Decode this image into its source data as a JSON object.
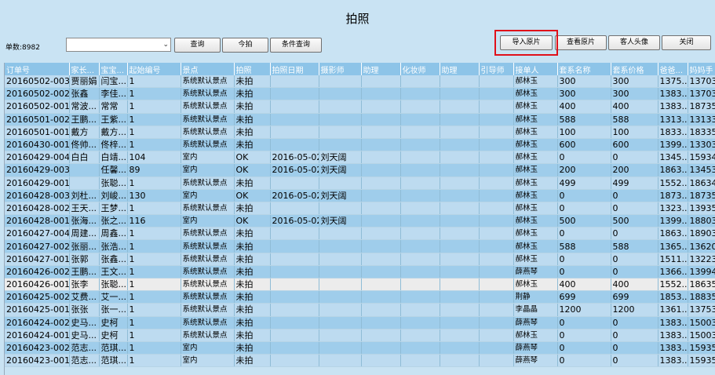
{
  "title": "拍照",
  "order_count": "单数:8982",
  "toolbar_left": [
    "查询",
    "今拍",
    "条件查询"
  ],
  "toolbar_right": [
    "导入原片",
    "查看原片",
    "客人头像",
    "关闭"
  ],
  "columns": [
    "订单号",
    "家长...",
    "宝宝...",
    "起始编号",
    "景点",
    "拍照",
    "拍照日期",
    "摄影师",
    "助理",
    "化妆师",
    "助理",
    "引导师",
    "接单人",
    "套系名称",
    "套系价格",
    "爸爸...",
    "妈妈手"
  ],
  "rows": [
    [
      "20160502-003",
      "贾丽娟",
      "闫宝...",
      "1",
      "系统默认景点",
      "未拍",
      "",
      "",
      "",
      "",
      "",
      "",
      "郝林玉",
      "300",
      "300",
      "1375...",
      "13703"
    ],
    [
      "20160502-002",
      "张鑫",
      "李佳...",
      "1",
      "系统默认景点",
      "未拍",
      "",
      "",
      "",
      "",
      "",
      "",
      "郝林玉",
      "300",
      "300",
      "1383...",
      "13703"
    ],
    [
      "20160502-001",
      "常波...",
      "常常",
      "1",
      "系统默认景点",
      "未拍",
      "",
      "",
      "",
      "",
      "",
      "",
      "郝林玉",
      "400",
      "400",
      "1383...",
      "18735"
    ],
    [
      "20160501-002",
      "王鹏...",
      "王紫...",
      "1",
      "系统默认景点",
      "未拍",
      "",
      "",
      "",
      "",
      "",
      "",
      "郝林玉",
      "588",
      "588",
      "1313...",
      "13133"
    ],
    [
      "20160501-001",
      "戴方",
      "戴方...",
      "1",
      "系统默认景点",
      "未拍",
      "",
      "",
      "",
      "",
      "",
      "",
      "郝林玉",
      "100",
      "100",
      "1833...",
      "18335"
    ],
    [
      "20160430-001",
      "佟帅...",
      "佟梓...",
      "1",
      "系统默认景点",
      "未拍",
      "",
      "",
      "",
      "",
      "",
      "",
      "郝林玉",
      "600",
      "600",
      "1399...",
      "13303"
    ],
    [
      "20160429-004",
      "白白",
      "白靖...",
      "104",
      "室内",
      "OK",
      "2016-05-02",
      "刘天阔",
      "",
      "",
      "",
      "",
      "郝林玉",
      "0",
      "0",
      "1345...",
      "15934"
    ],
    [
      "20160429-003",
      "",
      "任馨...",
      "89",
      "室内",
      "OK",
      "2016-05-02",
      "刘天阔",
      "",
      "",
      "",
      "",
      "郝林玉",
      "200",
      "200",
      "1863...",
      "13453"
    ],
    [
      "20160429-001",
      "",
      "张聪...",
      "1",
      "系统默认景点",
      "未拍",
      "",
      "",
      "",
      "",
      "",
      "",
      "郝林玉",
      "499",
      "499",
      "1552...",
      "18634"
    ],
    [
      "20160428-003",
      "刘杜...",
      "刘峻...",
      "130",
      "室内",
      "OK",
      "2016-05-02",
      "刘天阔",
      "",
      "",
      "",
      "",
      "郝林玉",
      "0",
      "0",
      "1873...",
      "18735"
    ],
    [
      "20160428-002",
      "王天...",
      "王梦...",
      "1",
      "系统默认景点",
      "未拍",
      "",
      "",
      "",
      "",
      "",
      "",
      "郝林玉",
      "0",
      "0",
      "1323...",
      "13935"
    ],
    [
      "20160428-001",
      "张海...",
      "张之...",
      "116",
      "室内",
      "OK",
      "2016-05-02",
      "刘天阔",
      "",
      "",
      "",
      "",
      "郝林玉",
      "500",
      "500",
      "1399...",
      "18803"
    ],
    [
      "20160427-004",
      "周建...",
      "周鑫...",
      "1",
      "系统默认景点",
      "未拍",
      "",
      "",
      "",
      "",
      "",
      "",
      "郝林玉",
      "0",
      "0",
      "1863...",
      "18903"
    ],
    [
      "20160427-002",
      "张丽...",
      "张浩...",
      "1",
      "系统默认景点",
      "未拍",
      "",
      "",
      "",
      "",
      "",
      "",
      "郝林玉",
      "588",
      "588",
      "1365...",
      "13620"
    ],
    [
      "20160427-001",
      "张郭",
      "张鑫...",
      "1",
      "系统默认景点",
      "未拍",
      "",
      "",
      "",
      "",
      "",
      "",
      "郝林玉",
      "0",
      "0",
      "1511...",
      "13223"
    ],
    [
      "20160426-002",
      "王鹏...",
      "王文...",
      "1",
      "系统默认景点",
      "未拍",
      "",
      "",
      "",
      "",
      "",
      "",
      "薛燕琴",
      "0",
      "0",
      "1366...",
      "13994"
    ],
    [
      "20160426-001",
      "张李",
      "张聪...",
      "1",
      "系统默认景点",
      "未拍",
      "",
      "",
      "",
      "",
      "",
      "",
      "郝林玉",
      "400",
      "400",
      "1552...",
      "18635"
    ],
    [
      "20160425-002",
      "艾费...",
      "艾一...",
      "1",
      "系统默认景点",
      "未拍",
      "",
      "",
      "",
      "",
      "",
      "",
      "荆静",
      "699",
      "699",
      "1853...",
      "18835"
    ],
    [
      "20160425-001",
      "张张",
      "张一...",
      "1",
      "系统默认景点",
      "未拍",
      "",
      "",
      "",
      "",
      "",
      "",
      "李晶晶",
      "1200",
      "1200",
      "1361...",
      "13753"
    ],
    [
      "20160424-002",
      "史马...",
      "史柯",
      "1",
      "系统默认景点",
      "未拍",
      "",
      "",
      "",
      "",
      "",
      "",
      "薛燕琴",
      "0",
      "0",
      "1383...",
      "15003"
    ],
    [
      "20160424-001",
      "史马...",
      "史柯",
      "1",
      "系统默认景点",
      "未拍",
      "",
      "",
      "",
      "",
      "",
      "",
      "郝林玉",
      "0",
      "0",
      "1383...",
      "15003"
    ],
    [
      "20160423-002",
      "范志...",
      "范琪...",
      "1",
      "室内",
      "未拍",
      "",
      "",
      "",
      "",
      "",
      "",
      "薛燕琴",
      "0",
      "0",
      "1383...",
      "15935"
    ],
    [
      "20160423-001",
      "范志...",
      "范琪...",
      "1",
      "室内",
      "未拍",
      "",
      "",
      "",
      "",
      "",
      "",
      "薛燕琴",
      "0",
      "0",
      "1383...",
      "15935"
    ]
  ],
  "selected_row": 16,
  "highlight_color": "#e0101a"
}
